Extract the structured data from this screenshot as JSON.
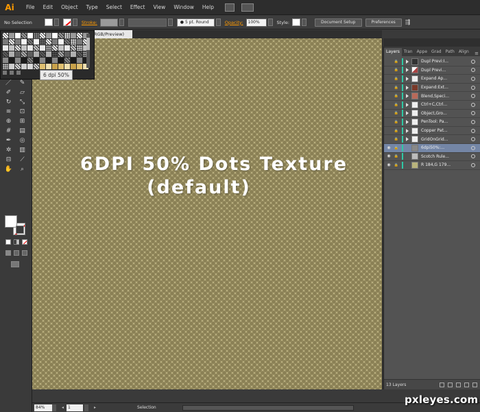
{
  "app": {
    "logo": "Ai"
  },
  "menu": [
    "File",
    "Edit",
    "Object",
    "Type",
    "Select",
    "Effect",
    "View",
    "Window",
    "Help"
  ],
  "control_bar": {
    "selection_label": "No Selection",
    "stroke_label": "Stroke:",
    "brush_label": "5 pt. Round",
    "opacity_label": "Opacity:",
    "opacity_value": "100%",
    "style_label": "Style:",
    "document_setup": "Document Setup",
    "preferences": "Preferences"
  },
  "document_tab": "RGB/Preview)",
  "swatch_tooltip": "6 dpi 50%",
  "canvas": {
    "title_line1": "6DPI 50% Dots Texture",
    "title_line2": "(default)"
  },
  "layers_panel": {
    "tabs": [
      "Layers",
      "Tran",
      "Appe",
      "Grad",
      "Path",
      "Align"
    ],
    "layers": [
      {
        "name": "Dupl Previ:I...",
        "visible": false,
        "selected": false
      },
      {
        "name": "Dupl Previ...",
        "visible": false,
        "selected": false
      },
      {
        "name": "Expand Ap...",
        "visible": false,
        "selected": false
      },
      {
        "name": "Expand:Ext...",
        "visible": false,
        "selected": false
      },
      {
        "name": "Blend,Speci...",
        "visible": false,
        "selected": false
      },
      {
        "name": "Ctrl+C,Ctrl...",
        "visible": false,
        "selected": false
      },
      {
        "name": "Object,Gro...",
        "visible": false,
        "selected": false
      },
      {
        "name": "PenTool: Pa...",
        "visible": false,
        "selected": false
      },
      {
        "name": "Copper Pat...",
        "visible": false,
        "selected": false
      },
      {
        "name": "GridOnGrid...",
        "visible": false,
        "selected": false
      },
      {
        "name": "6dpi50%:...",
        "visible": true,
        "selected": true
      },
      {
        "name": "Scotch Rule...",
        "visible": true,
        "selected": false
      },
      {
        "name": "R 184,G 179...",
        "visible": true,
        "selected": false
      }
    ],
    "count_label": "13 Layers"
  },
  "status_bar": {
    "zoom": "84%",
    "page": "1",
    "status": "Selection"
  },
  "watermark": "pxleyes.com",
  "colors": {
    "accent_orange": "#ff9a00",
    "canvas_bg": "#b8ae7e",
    "canvas_dot": "#8a8055",
    "selected_layer": "#7486a6",
    "layer_color_bar": "#2fc9a5"
  }
}
